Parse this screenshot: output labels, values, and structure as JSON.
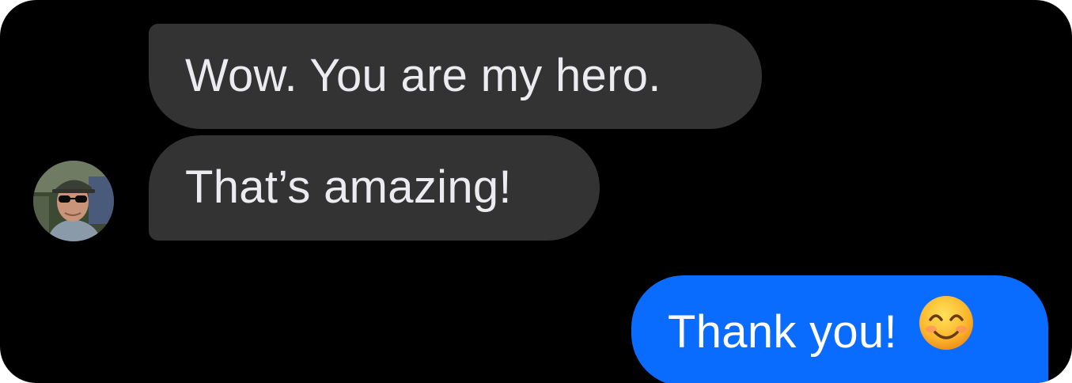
{
  "conversation": {
    "messages": [
      {
        "direction": "incoming",
        "text": "Wow. You are my hero."
      },
      {
        "direction": "incoming",
        "text": "That’s amazing!"
      },
      {
        "direction": "outgoing",
        "text": "Thank you!",
        "emoji": "smiling-face-with-smiling-eyes-icon"
      }
    ],
    "avatar_icon": "user-avatar-photo"
  },
  "colors": {
    "background": "#000000",
    "incoming_bubble": "#333333",
    "outgoing_bubble": "#0a6bff",
    "incoming_text": "#ebebf0",
    "outgoing_text": "#ffffff"
  }
}
